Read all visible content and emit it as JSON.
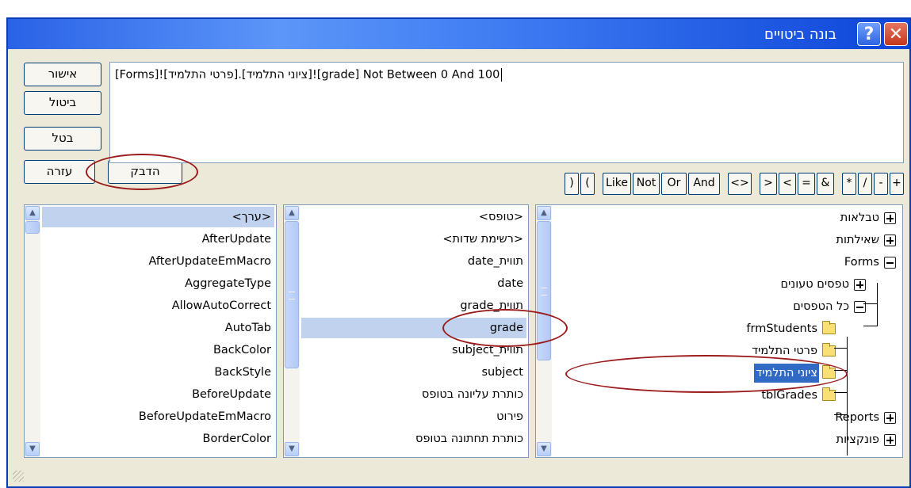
{
  "window": {
    "title": "בונה ביטויים",
    "help_label": "?",
    "close_label": "✕"
  },
  "buttons": {
    "ok": "אישור",
    "cancel": "ביטול",
    "undo": "בטל",
    "help": "עזרה",
    "paste": "הדבק"
  },
  "expression": {
    "value": "[Forms]![פרטי התלמיד].[ציוני התלמיד]![grade] Not Between 0 And 100"
  },
  "operators": [
    "+",
    "-",
    "/",
    "*",
    "&",
    "=",
    "<",
    ">",
    "<>",
    "And",
    "Or",
    "Not",
    "Like",
    "(",
    ")"
  ],
  "tree": {
    "items": [
      {
        "label": "טבלאות",
        "icon": "plus"
      },
      {
        "label": "שאילתות",
        "icon": "plus"
      },
      {
        "label": "Forms",
        "icon": "minus"
      },
      {
        "label": "טפסים טעונים",
        "icon": "plus"
      },
      {
        "label": "כל הטפסים",
        "icon": "minus"
      },
      {
        "label": "frmStudents",
        "icon": "folder"
      },
      {
        "label": "פרטי התלמיד",
        "icon": "folder"
      },
      {
        "label": "ציוני התלמיד",
        "icon": "folder-open"
      },
      {
        "label": "tblGrades",
        "icon": "folder"
      },
      {
        "label": "Reports",
        "icon": "plus"
      },
      {
        "label": "פונקציות",
        "icon": "plus"
      }
    ]
  },
  "middle_list": {
    "items": [
      "<טופס>",
      "<רשימת שדות>",
      "תווית_date",
      "date",
      "תווית_grade",
      "grade",
      "תווית_subject",
      "subject",
      "כותרת עליונה בטופס",
      "פירוט",
      "כותרת תחתונה בטופס"
    ]
  },
  "right_list": {
    "items": [
      "<ערך>",
      "AfterUpdate",
      "AfterUpdateEmMacro",
      "AggregateType",
      "AllowAutoCorrect",
      "AutoTab",
      "BackColor",
      "BackStyle",
      "BeforeUpdate",
      "BeforeUpdateEmMacro",
      "BorderColor"
    ]
  },
  "colors": {
    "titlebar": "#2a62e6",
    "selection": "#316ac5",
    "annotation": "#9b1a1a",
    "dialog_bg": "#ece9d8"
  }
}
